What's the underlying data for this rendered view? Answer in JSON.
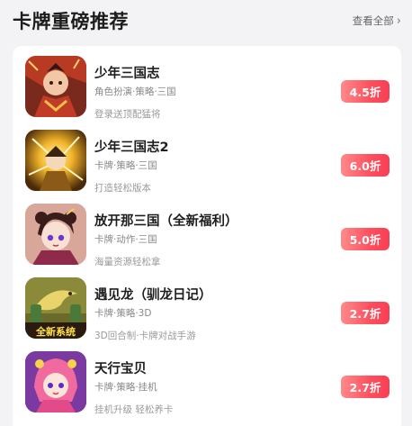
{
  "section": {
    "title": "卡牌重磅推荐",
    "see_all_label": "查看全部",
    "see_all_icon": "chevron-right-icon"
  },
  "colors": {
    "background": "#f3f3f5",
    "card": "#ffffff",
    "badge_from": "#ff8a8a",
    "badge_to": "#f73f53"
  },
  "games": [
    {
      "name": "少年三国志",
      "tags": "角色扮演·策略·三国",
      "desc": "登录送顶配猛将",
      "discount": "4.5折",
      "icon": "game-icon-general-red-armor"
    },
    {
      "name": "少年三国志2",
      "tags": "卡牌·策略·三国",
      "desc": "打造轻松版本",
      "discount": "6.0折",
      "icon": "game-icon-golden-warrior"
    },
    {
      "name": "放开那三国（全新福利）",
      "tags": "卡牌·动作·三国",
      "desc": "海量资源轻松拿",
      "discount": "5.0折",
      "icon": "game-icon-anime-girl"
    },
    {
      "name": "遇见龙（驯龙日记）",
      "tags": "卡牌·策略·3D",
      "desc": "3D回合制·卡牌对战手游",
      "discount": "2.7折",
      "icon": "game-icon-dragon",
      "icon_text": "全新系统"
    },
    {
      "name": "天行宝贝",
      "tags": "卡牌·策略·挂机",
      "desc": "挂机升级 轻松养卡",
      "discount": "2.7折",
      "icon": "game-icon-pink-hair-girl"
    }
  ]
}
